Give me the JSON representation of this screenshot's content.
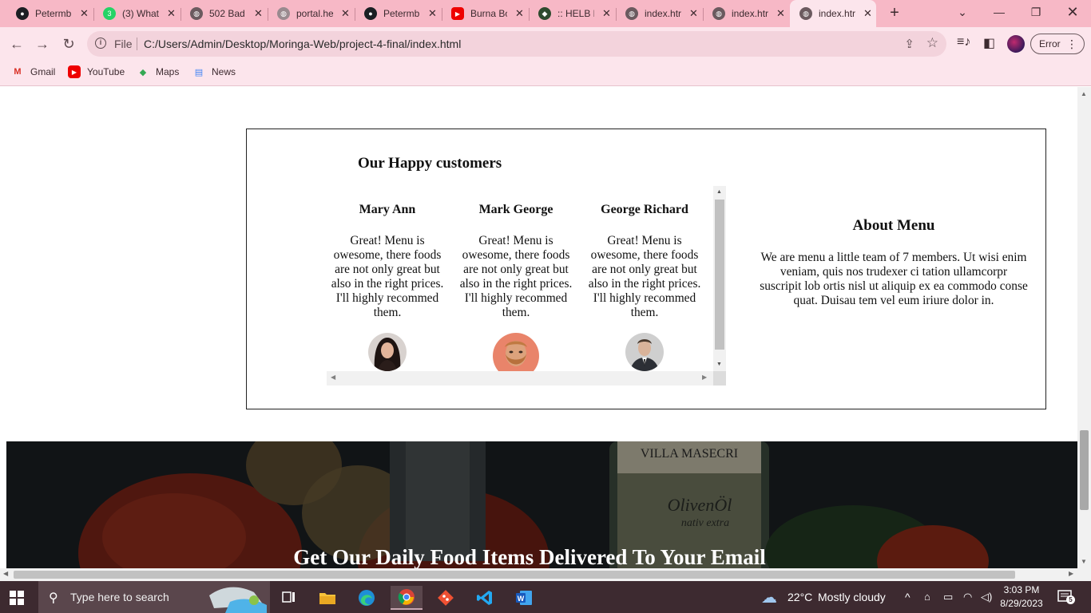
{
  "browser": {
    "tabs": [
      {
        "title": "Petermb",
        "icon": "github-icon"
      },
      {
        "title": "(3) What",
        "icon": "whatsapp-icon",
        "badge": "3"
      },
      {
        "title": "502 Bad",
        "icon": "globe-icon"
      },
      {
        "title": "portal.he",
        "icon": "globe-icon"
      },
      {
        "title": "Petermb",
        "icon": "github-icon"
      },
      {
        "title": "Burna Bo",
        "icon": "youtube-icon"
      },
      {
        "title": ":: HELB P",
        "icon": "helb-icon"
      },
      {
        "title": "index.htr",
        "icon": "globe-icon"
      },
      {
        "title": "index.htr",
        "icon": "globe-icon"
      },
      {
        "title": "index.htr",
        "icon": "globe-icon",
        "active": true
      }
    ],
    "address": {
      "scheme_label": "File",
      "url": "C:/Users/Admin/Desktop/Moringa-Web/project-4-final/index.html"
    },
    "profile_status": "Error",
    "bookmarks": [
      {
        "label": "Gmail",
        "icon": "gmail-icon"
      },
      {
        "label": "YouTube",
        "icon": "youtube-icon"
      },
      {
        "label": "Maps",
        "icon": "maps-icon"
      },
      {
        "label": "News",
        "icon": "news-icon"
      }
    ]
  },
  "page": {
    "customers_title": "Our Happy customers",
    "testimonials": [
      {
        "name": "Mary Ann",
        "quote": "Great! Menu is owesome, there foods are not only great but also in the right prices. I'll highly recommed them.",
        "avatar": "woman-avatar"
      },
      {
        "name": "Mark George",
        "quote": "Great! Menu is owesome, there foods are not only great but also in the right prices. I'll highly recommed them.",
        "avatar": "bearded-man-avatar"
      },
      {
        "name": "George Richard",
        "quote": "Great! Menu is owesome, there foods are not only great but also in the right prices. I'll highly recommed them.",
        "avatar": "man-in-suit-avatar"
      }
    ],
    "about": {
      "title": "About Menu",
      "text": "We are menu a little team of 7 members. Ut wisi enim veniam, quis nos trudexer ci tation ullamcorpr suscripit lob ortis nisl ut aliquip ex ea commodo conse quat. Duisau tem vel eum iriure dolor in."
    },
    "hero": {
      "title": "Get Our Daily Food Items Delivered To Your Email",
      "bottle_label": "VILLA MASECRI",
      "bottle_brand": "OlivenÖl",
      "bottle_sub": "nativ extra"
    }
  },
  "taskbar": {
    "search_placeholder": "Type here to search",
    "apps": [
      "task-view-icon",
      "file-explorer-icon",
      "edge-icon",
      "chrome-icon",
      "git-icon",
      "vscode-icon",
      "word-icon"
    ],
    "weather": {
      "temp": "22°C",
      "condition": "Mostly cloudy"
    },
    "time": "3:03 PM",
    "date": "8/29/2023",
    "notifications": "5"
  },
  "colors": {
    "tab_strip": "#f7b8c6",
    "toolbar": "#fce5ec",
    "taskbar": "#3d2a30",
    "hero_bg": "#1f2428"
  }
}
